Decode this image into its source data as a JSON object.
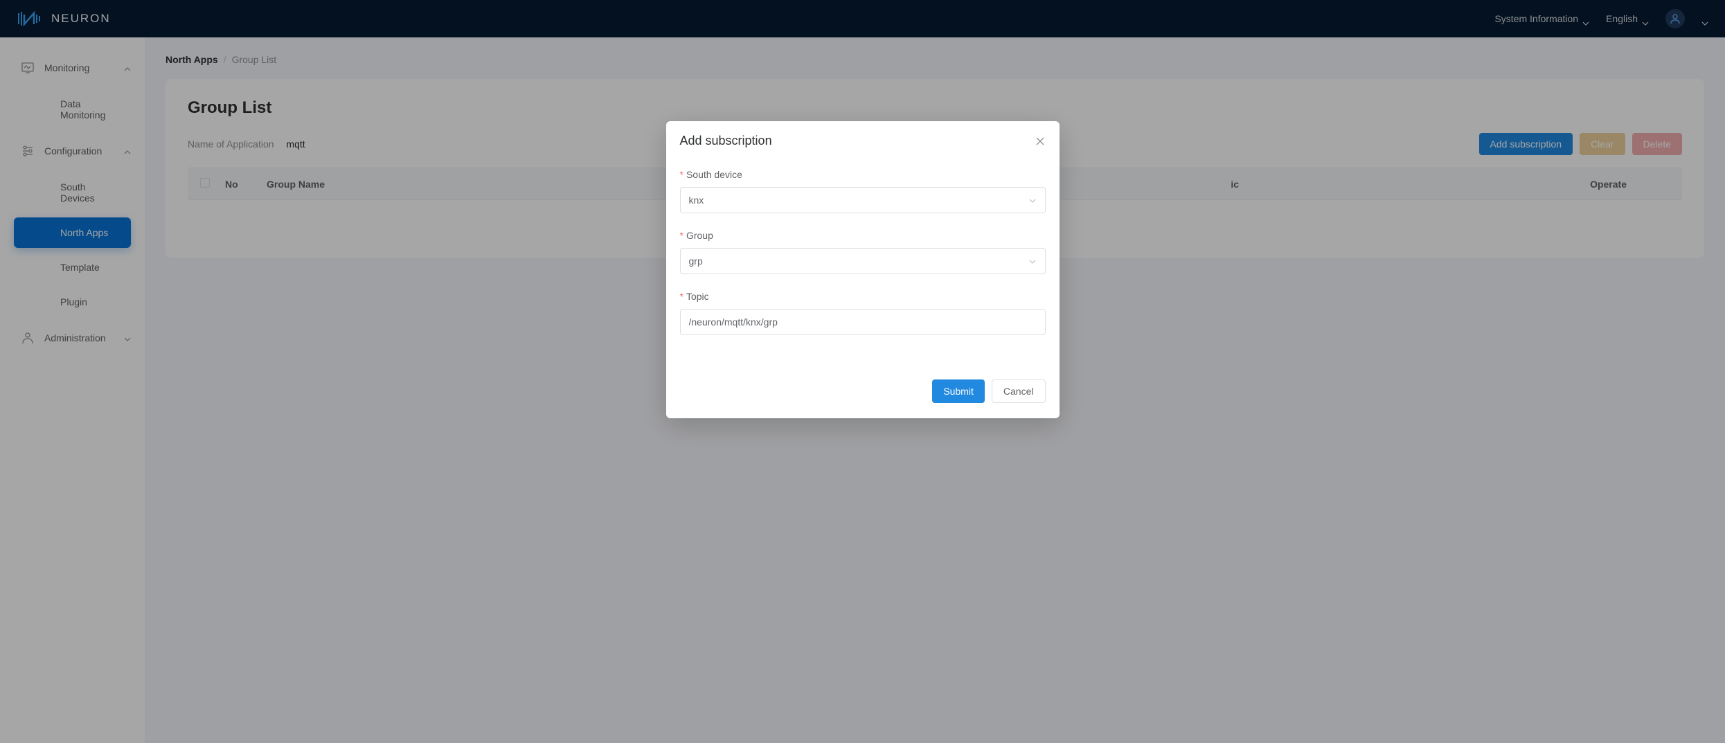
{
  "header": {
    "brand": "NEURON",
    "system_info_label": "System Information",
    "language_label": "English"
  },
  "sidebar": {
    "monitoring": {
      "label": "Monitoring",
      "items": [
        {
          "label": "Data Monitoring"
        }
      ]
    },
    "configuration": {
      "label": "Configuration",
      "items": [
        {
          "label": "South Devices"
        },
        {
          "label": "North Apps"
        },
        {
          "label": "Template"
        },
        {
          "label": "Plugin"
        }
      ]
    },
    "administration": {
      "label": "Administration"
    }
  },
  "breadcrumb": {
    "first": "North Apps",
    "sep": "/",
    "second": "Group List"
  },
  "page": {
    "title": "Group List",
    "app_name_label": "Name of Application",
    "app_name_value": "mqtt",
    "actions": {
      "add_subscription": "Add subscription",
      "clear": "Clear",
      "delete": "Delete"
    },
    "table": {
      "columns": {
        "no": "No",
        "group_name": "Group Name",
        "topic_suffix": "ic",
        "operate": "Operate"
      }
    }
  },
  "modal": {
    "title": "Add subscription",
    "fields": {
      "south_device_label": "South device",
      "south_device_value": "knx",
      "group_label": "Group",
      "group_value": "grp",
      "topic_label": "Topic",
      "topic_value": "/neuron/mqtt/knx/grp"
    },
    "buttons": {
      "submit": "Submit",
      "cancel": "Cancel"
    }
  }
}
